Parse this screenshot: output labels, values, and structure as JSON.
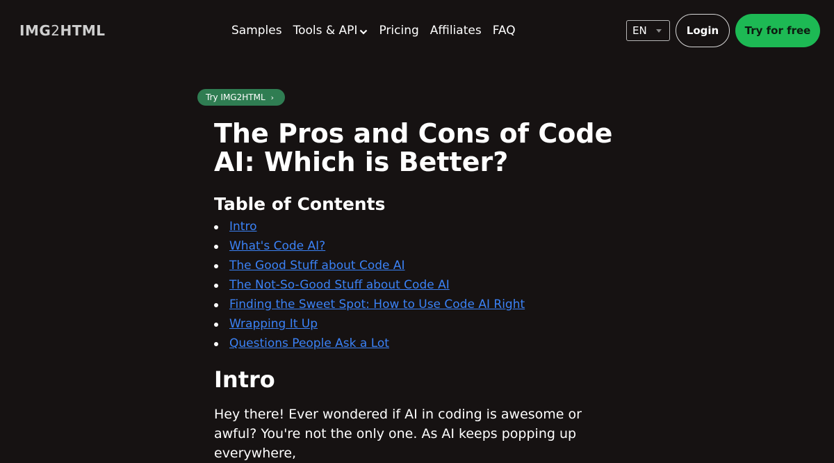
{
  "header": {
    "logo_prefix": "IMG",
    "logo_middle": "2",
    "logo_suffix": "HTML",
    "nav": [
      {
        "label": "Samples"
      },
      {
        "label": "Tools & API"
      },
      {
        "label": "Pricing"
      },
      {
        "label": "Affiliates"
      },
      {
        "label": "FAQ"
      }
    ],
    "language": "EN",
    "login_label": "Login",
    "cta_label": "Try for free"
  },
  "badge": {
    "label": "Try IMG2HTML",
    "arrow": "›"
  },
  "article": {
    "title": "The Pros and Cons of Code AI: Which is Better?",
    "toc_heading": "Table of Contents",
    "toc": [
      "Intro",
      "What's Code AI?",
      "The Good Stuff about Code AI",
      "The Not-So-Good Stuff about Code AI",
      "Finding the Sweet Spot: How to Use Code AI Right",
      "Wrapping It Up",
      "Questions People Ask a Lot"
    ],
    "intro_heading": "Intro",
    "intro_text": "Hey there! Ever wondered if AI in coding is awesome or awful? You're not the only one. As AI keeps popping up everywhere,"
  },
  "colors": {
    "background": "#161212",
    "accent_green": "#1db954",
    "badge_green": "#2f7d52",
    "link_blue": "#3b82f6"
  }
}
